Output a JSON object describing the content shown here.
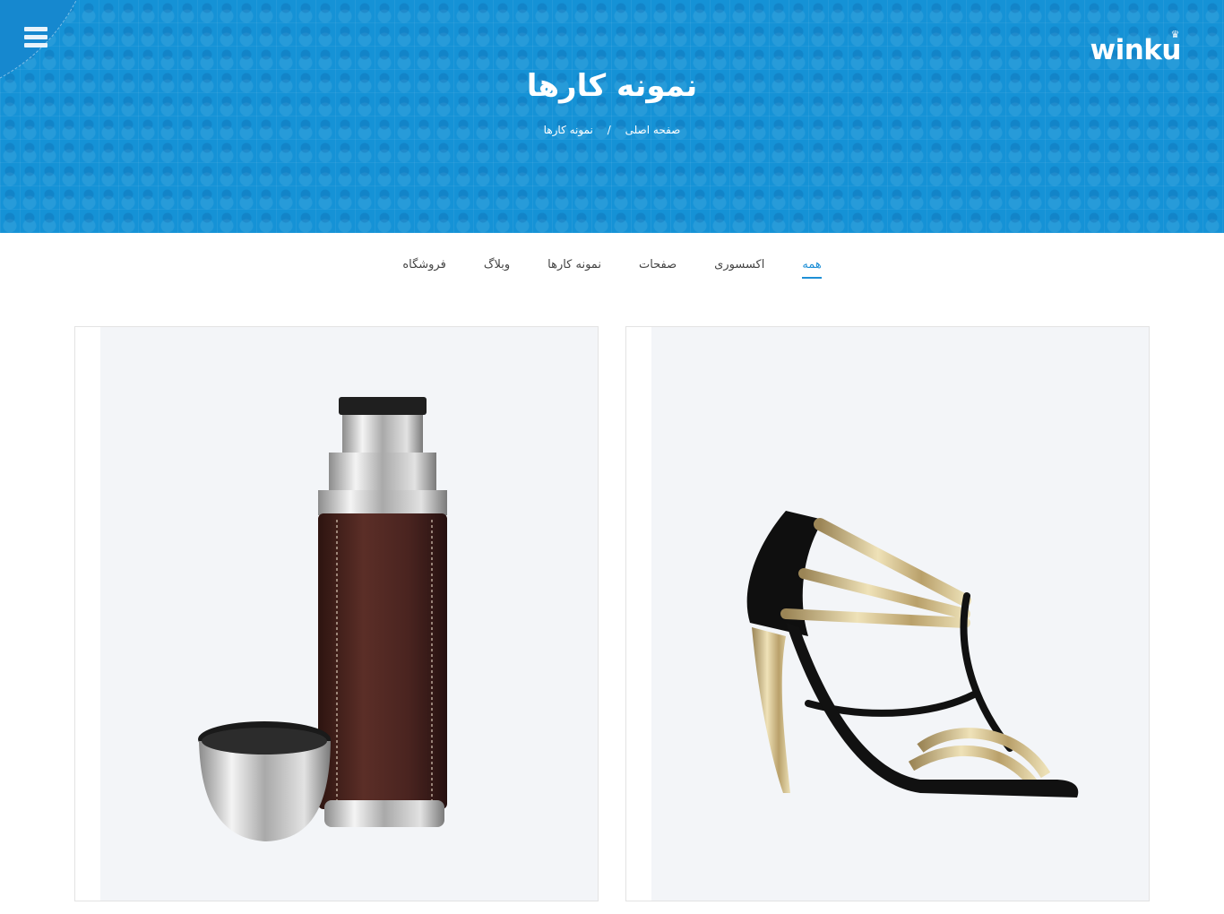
{
  "header": {
    "logo": "winku",
    "title": "نمونه کارها",
    "breadcrumb": {
      "home": "صفحه اصلی",
      "separator": "/",
      "current": "نمونه کارها"
    }
  },
  "filters": {
    "items": [
      {
        "label": "همه",
        "active": true
      },
      {
        "label": "اکسسوری",
        "active": false
      },
      {
        "label": "صفحات",
        "active": false
      },
      {
        "label": "نمونه کارها",
        "active": false
      },
      {
        "label": "وبلاگ",
        "active": false
      },
      {
        "label": "فروشگاه",
        "active": false
      }
    ]
  },
  "portfolio": {
    "items": [
      {
        "image": "thermos-flask"
      },
      {
        "image": "gold-strappy-high-heel-sandal"
      }
    ]
  },
  "colors": {
    "brand": "#1592d6",
    "accent": "#1e8fd6",
    "text": "#444444"
  }
}
